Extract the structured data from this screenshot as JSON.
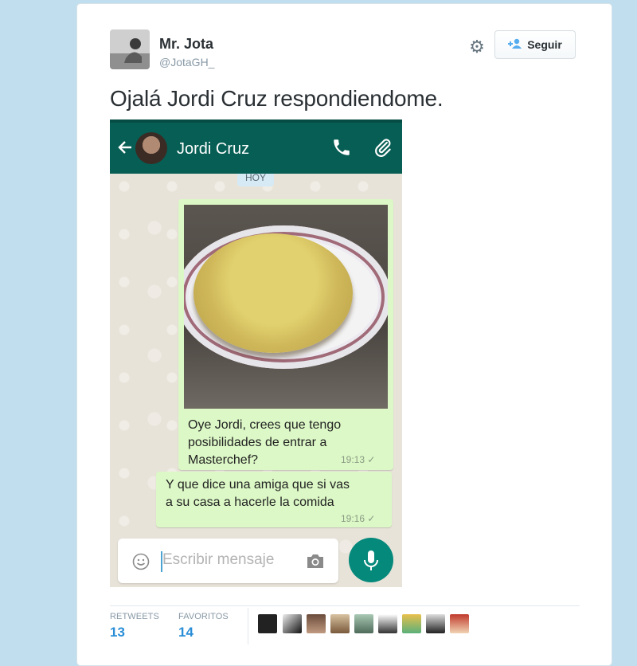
{
  "tweet": {
    "author_name": "Mr. Jota",
    "author_handle": "@JotaGH_",
    "follow_label": "Seguir",
    "text": "Ojalá Jordi Cruz respondiendome."
  },
  "chat": {
    "contact_name": "Jordi Cruz",
    "date_chip": "HOY",
    "message1": {
      "lines": [
        "Oye Jordi,  crees que tengo",
        "posibilidades de entrar a",
        "Masterchef?"
      ],
      "time": "19:13"
    },
    "message2": {
      "lines": [
        "Y que dice una amiga que si vas",
        "a su casa a hacerle la comida"
      ],
      "time": "19:16"
    },
    "input_placeholder": "Escribir mensaje"
  },
  "stats": {
    "retweets_label": "RETWEETS",
    "retweets_value": "13",
    "favorites_label": "FAVORITOS",
    "favorites_value": "14"
  },
  "colors": {
    "page_bg": "#c0deed",
    "whatsapp_header": "#075e54",
    "bubble": "#dcf8c6",
    "link_blue": "#2a8ed6"
  }
}
